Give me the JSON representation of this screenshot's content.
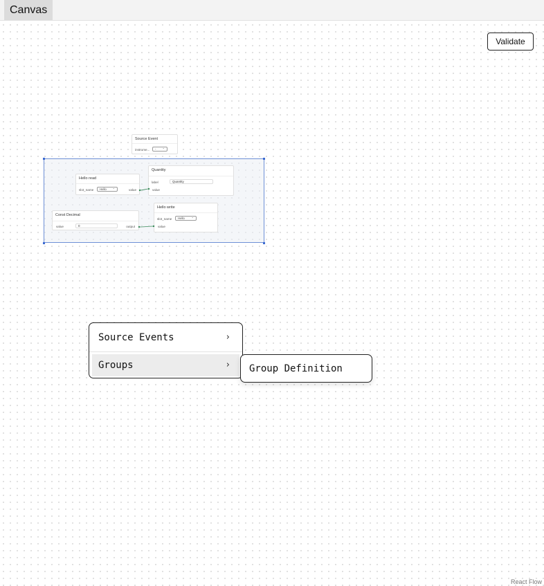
{
  "header": {
    "tab_label": "Canvas"
  },
  "toolbar": {
    "validate_label": "Validate"
  },
  "nodes": {
    "source_event": {
      "title": "Source Event",
      "field_label": "instrume...",
      "select_value": "-"
    },
    "quantity": {
      "title": "Quantity",
      "label_field": "label",
      "label_value": "Quantity",
      "value_port": "value"
    },
    "hello_read": {
      "title": "Hello read",
      "field_label": "slot_name",
      "select_value": "Hello",
      "output_port": "value"
    },
    "const_decimal": {
      "title": "Const Decimal",
      "field_label": "value",
      "input_value": "0",
      "output_port": "output"
    },
    "hello_write": {
      "title": "Hello write",
      "field_label": "slot_name",
      "select_value": "Hello",
      "value_port": "value"
    }
  },
  "context_menu": {
    "items": [
      {
        "label": "Source Events",
        "icon": "chevron-right-icon"
      },
      {
        "label": "Groups",
        "icon": "chevron-right-icon"
      }
    ],
    "submenu": {
      "items": [
        {
          "label": "Group Definition"
        }
      ]
    }
  },
  "footer": {
    "attribution": "React Flow"
  },
  "colors": {
    "edge": "#3a8a5a",
    "selection": "#3d6bd1"
  }
}
